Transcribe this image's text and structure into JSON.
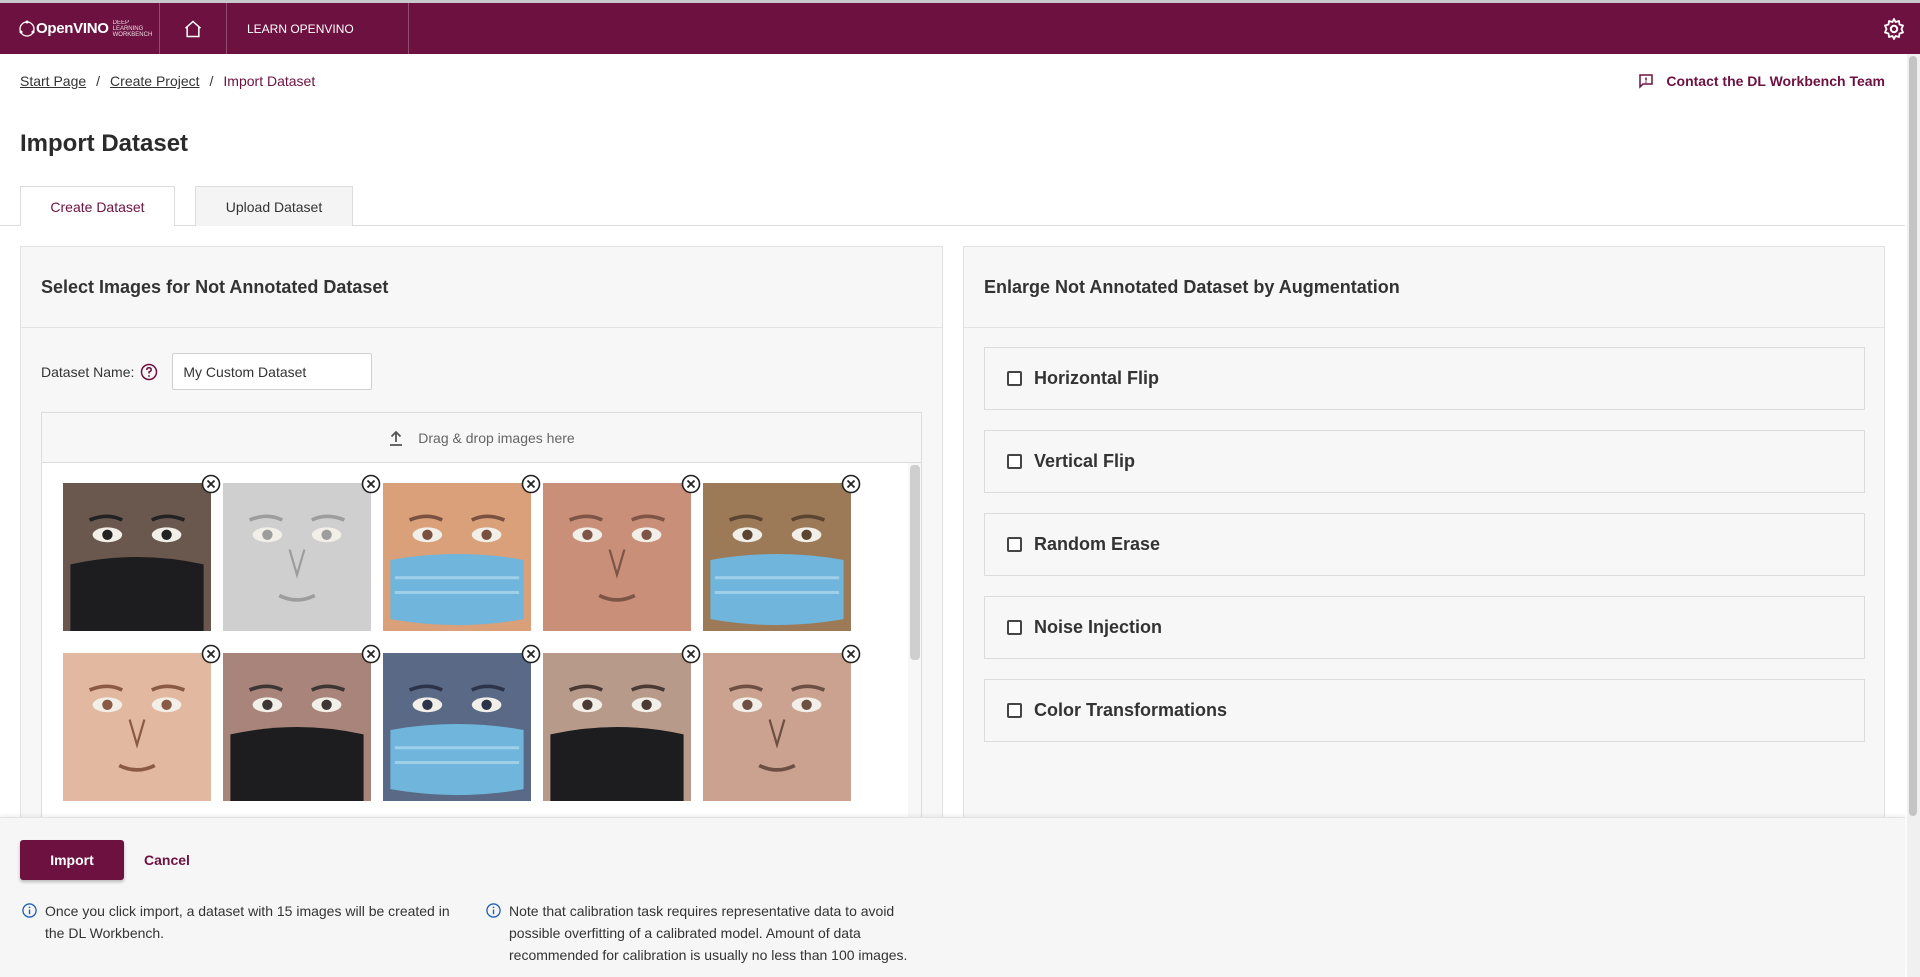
{
  "topbar": {
    "logo_text": "OpenVINO",
    "logo_subtitle": "Deep Learning Workbench",
    "learn_label": "LEARN OPENVINO",
    "bg_color": "#6d1140"
  },
  "breadcrumb": {
    "items": [
      "Start Page",
      "Create Project"
    ],
    "current": "Import Dataset",
    "separator": "/"
  },
  "contact_label": "Contact the DL Workbench Team",
  "page_title": "Import Dataset",
  "tabs": [
    {
      "label": "Create Dataset",
      "active": true
    },
    {
      "label": "Upload Dataset",
      "active": false
    }
  ],
  "left_panel": {
    "title": "Select Images for Not Annotated Dataset",
    "dataset_name_label": "Dataset Name:",
    "dataset_name_value": "My Custom Dataset",
    "dropzone_label": "Drag & drop images here",
    "images": [
      {
        "name": "face-1",
        "tone": "#6a584f",
        "accent": "#222222",
        "mask": "dark"
      },
      {
        "name": "face-2",
        "tone": "#cfcfcf",
        "accent": "#9d9d9d",
        "mask": "none"
      },
      {
        "name": "face-3",
        "tone": "#d9a079",
        "accent": "#7a5040",
        "mask": "blue"
      },
      {
        "name": "face-4",
        "tone": "#c98f78",
        "accent": "#7e5447",
        "mask": "none"
      },
      {
        "name": "face-5",
        "tone": "#9c7a57",
        "accent": "#5b4430",
        "mask": "blue"
      },
      {
        "name": "face-6",
        "tone": "#e2b8a0",
        "accent": "#8a5a45",
        "mask": "none"
      },
      {
        "name": "face-7",
        "tone": "#a8847a",
        "accent": "#3e3535",
        "mask": "dark"
      },
      {
        "name": "face-8",
        "tone": "#5a6a86",
        "accent": "#2d344a",
        "mask": "blue"
      },
      {
        "name": "face-9",
        "tone": "#b89a8a",
        "accent": "#4a3a33",
        "mask": "dark"
      },
      {
        "name": "face-10",
        "tone": "#caa28f",
        "accent": "#6d4f43",
        "mask": "none"
      }
    ]
  },
  "right_panel": {
    "title": "Enlarge Not Annotated Dataset by Augmentation",
    "options": [
      {
        "label": "Horizontal Flip",
        "checked": false
      },
      {
        "label": "Vertical Flip",
        "checked": false
      },
      {
        "label": "Random Erase",
        "checked": false
      },
      {
        "label": "Noise Injection",
        "checked": false
      },
      {
        "label": "Color Transformations",
        "checked": false
      }
    ]
  },
  "footer": {
    "import_label": "Import",
    "cancel_label": "Cancel",
    "note1": "Once you click import, a dataset with 15 images will be created in the DL Workbench.",
    "note2": "Note that calibration task requires representative data to avoid possible overfitting of a calibrated model. Amount of data recommended for calibration is usually no less than 100 images."
  }
}
